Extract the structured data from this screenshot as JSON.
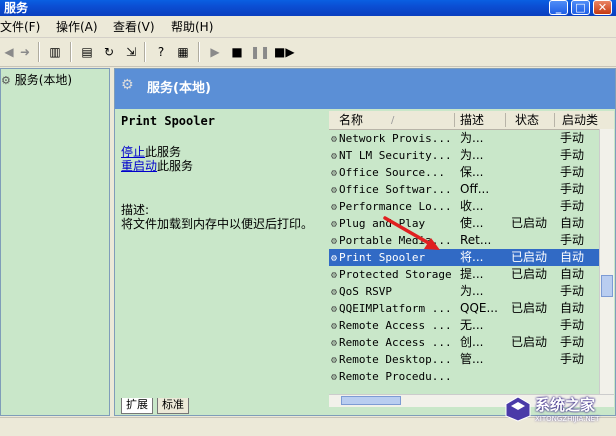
{
  "window": {
    "title": "服务"
  },
  "menu": [
    "文件(F)",
    "操作(A)",
    "查看(V)",
    "帮助(H)"
  ],
  "tree": {
    "root": "服务(本地)"
  },
  "header": {
    "title": "服务(本地)"
  },
  "detail": {
    "service_name": "Print Spooler",
    "stop_link": "停止",
    "stop_suffix": "此服务",
    "restart_link": "重启动",
    "restart_suffix": "此服务",
    "desc_label": "描述:",
    "desc_text": "将文件加载到内存中以便迟后打印。"
  },
  "columns": {
    "name": "名称",
    "desc": "描述",
    "status": "状态",
    "startup": "启动类"
  },
  "rows": [
    {
      "name": "Network Provis...",
      "desc": "为...",
      "status": "",
      "startup": "手动"
    },
    {
      "name": "NT LM Security...",
      "desc": "为...",
      "status": "",
      "startup": "手动"
    },
    {
      "name": "Office  Source...",
      "desc": "保...",
      "status": "",
      "startup": "手动"
    },
    {
      "name": "Office Softwar...",
      "desc": "Off...",
      "status": "",
      "startup": "手动"
    },
    {
      "name": "Performance Lo...",
      "desc": "收...",
      "status": "",
      "startup": "手动"
    },
    {
      "name": "Plug and Play",
      "desc": "使...",
      "status": "已启动",
      "startup": "自动"
    },
    {
      "name": "Portable Media...",
      "desc": "Ret...",
      "status": "",
      "startup": "手动"
    },
    {
      "name": "Print Spooler",
      "desc": "将...",
      "status": "已启动",
      "startup": "自动",
      "selected": true
    },
    {
      "name": "Protected Storage",
      "desc": "提...",
      "status": "已启动",
      "startup": "自动"
    },
    {
      "name": "QoS RSVP",
      "desc": "为...",
      "status": "",
      "startup": "手动"
    },
    {
      "name": "QQEIMPlatform ...",
      "desc": "QQE...",
      "status": "已启动",
      "startup": "自动"
    },
    {
      "name": "Remote Access ...",
      "desc": "无...",
      "status": "",
      "startup": "手动"
    },
    {
      "name": "Remote Access ...",
      "desc": "创...",
      "status": "已启动",
      "startup": "手动"
    },
    {
      "name": "Remote Desktop...",
      "desc": "管...",
      "status": "",
      "startup": "手动"
    },
    {
      "name": "Remote Procedu...",
      "desc": "",
      "status": "",
      "startup": ""
    }
  ],
  "tabs": [
    "扩展",
    "标准"
  ],
  "watermark": {
    "cn": "系统之家",
    "en": "XITONGZHIJIA.NET"
  },
  "colors": {
    "selection": "#316ac5",
    "pane": "#c9e7c9",
    "header": "#5b8fd6",
    "arrow": "#e02020"
  }
}
